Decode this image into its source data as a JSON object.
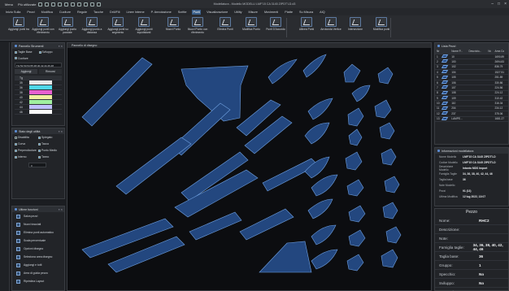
{
  "titlebar": {
    "menu": "Menu",
    "recent": "Più utilizzate",
    "title": "Modellatura - Modello MODELLI LMF'15 CA 3145 ZIPDT'LD.d3"
  },
  "tabs": [
    "Inizio Sulla",
    "Pezzi",
    "Modifica",
    "Cuciture",
    "Regole",
    "Tacche",
    "Drill/Fili",
    "Linee Interne",
    "P. Annotazione",
    "Scritte",
    "Punti",
    "Visualizzazione",
    "Utility",
    "Misure",
    "Movimenti",
    "Piatte",
    "Su Misura",
    "AIQ"
  ],
  "active_tab": "Punti",
  "ribbon": [
    "Aggiungi punti tra",
    "Aggiungi punti con riferimento",
    "Aggiungi punto parziale",
    "Aggiungi punto a distanza",
    "Aggiungi punti su segmento",
    "Aggiungi punti equidistanti",
    "Muovi Punto",
    "Muovi Punto con riferimento",
    "Elimina Punti",
    "Modifica Punto",
    "Punti D'Accordo",
    "Allinea Punti",
    "Arrotonda Vertice",
    "Intersezione",
    "Modifica punti"
  ],
  "panels": {
    "tools_title": "Pannello Strumenti",
    "taglie_base": "Taglie Base",
    "sviluppo": "Sviluppo",
    "cuciture": "Cuciture",
    "size_list_text": "TG:52,50,54,55,38,40,42,44,46,48",
    "aggiungi": "Aggiungi",
    "rimuovi": "Rimuovi",
    "col_tg": "Tg",
    "sizes": [
      {
        "n": "35",
        "color": "#e8e8e8"
      },
      {
        "n": "36",
        "color": "#4fd8e8"
      },
      {
        "n": "38",
        "color": "#e860d0"
      },
      {
        "n": "40",
        "color": "#f0f0a0"
      },
      {
        "n": "42",
        "color": "#a0f0a0"
      },
      {
        "n": "44",
        "color": "#c0c0ff"
      },
      {
        "n": "46",
        "color": "#ffffff"
      }
    ],
    "status_title": "Stato degli utilità",
    "status_items": [
      "Disabilita",
      "Spiegato",
      "Curva",
      "Tacca",
      "Perpendicolare",
      "Punto Medio",
      "Interno",
      "Tanno"
    ],
    "value_box": "0",
    "functions_title": "Ultime funzioni",
    "functions": [
      "Salva pezzi",
      "Nuovi tracciati",
      "Elimina punti automatico",
      "Scala percentuale",
      "Opzioni disegno",
      "Seleziona area disegno",
      "Aggiungi e tutti",
      "Area di guida pezzo",
      "Ripristina Layout"
    ]
  },
  "canvas_title": "Pannello di disegno",
  "pieces_panel": {
    "title": "Lista Pezzi",
    "headers": [
      "Nr",
      "",
      "Nome P...",
      "Descrizio...",
      "Nr.",
      "Area Co"
    ],
    "rows": [
      [
        "1",
        "",
        "10",
        "",
        "",
        "1690.89"
      ],
      [
        "2",
        "",
        "100",
        "",
        "",
        "2694.83"
      ],
      [
        "3",
        "",
        "102",
        "",
        "",
        "836.79"
      ],
      [
        "4",
        "",
        "104",
        "",
        "",
        "1527.51"
      ],
      [
        "5",
        "",
        "105",
        "",
        "",
        "251.89"
      ],
      [
        "6",
        "",
        "106",
        "",
        "",
        "330.86"
      ],
      [
        "7",
        "",
        "107",
        "",
        "",
        "224.56"
      ],
      [
        "8",
        "",
        "108",
        "",
        "",
        "224.12"
      ],
      [
        "9",
        "",
        "109",
        "",
        "",
        "310.42"
      ],
      [
        "10",
        "",
        "110",
        "",
        "",
        "316.34"
      ],
      [
        "11",
        "",
        "204",
        "",
        "",
        "234.12"
      ],
      [
        "12",
        "",
        "237",
        "",
        "",
        "375.06"
      ],
      [
        "13",
        "",
        "LAMPE...",
        "",
        "",
        "1681.27"
      ]
    ]
  },
  "model_info": {
    "title": "Informazioni modellatura",
    "rows": [
      {
        "k": "Nome Modello",
        "v": "LMF'15 CA 3145 ZIPDT'LD"
      },
      {
        "k": "Codice Modello",
        "v": "LMF'15 CA 3145 ZIPDT'LD"
      },
      {
        "k": "Descrizione Modello",
        "v": "Intanto MDS Import"
      },
      {
        "k": "Famiglia Taglie",
        "v": "34, 36, 38, 40, 42, 44, 46"
      },
      {
        "k": "Taglia base",
        "v": "36"
      },
      {
        "k": "Note Modello",
        "v": ""
      },
      {
        "k": "Pezzi",
        "v": "91 (13)"
      },
      {
        "k": "Ultima Modifica",
        "v": "12 lug 2022, 13:07"
      }
    ]
  },
  "pezzo": {
    "title": "Pezzo",
    "rows": [
      {
        "k": "Nome:",
        "v": "RHC2"
      },
      {
        "k": "Descrizione:",
        "v": ""
      },
      {
        "k": "Note:",
        "v": ""
      },
      {
        "k": "Famiglia taglie:",
        "v": "34, 36, 38, 40, 42, 44, 46"
      },
      {
        "k": "Taglia base:",
        "v": "36"
      },
      {
        "k": "Gruppo:",
        "v": "1"
      },
      {
        "k": "Specchio:",
        "v": "No"
      },
      {
        "k": "Sviluppo:",
        "v": "No"
      },
      {
        "k": "Nr. Punti:",
        "v": "19"
      }
    ]
  },
  "colors": {
    "piece_fill": "#23477f",
    "piece_stroke": "#6fa0e0",
    "accent": "#3a5f8a"
  },
  "icons": [
    "search-icon",
    "undo-icon",
    "redo-icon",
    "pointer-icon",
    "zoom-icon",
    "pin-icon",
    "close-icon",
    "minimize-icon",
    "maximize-icon",
    "piece-icon"
  ]
}
